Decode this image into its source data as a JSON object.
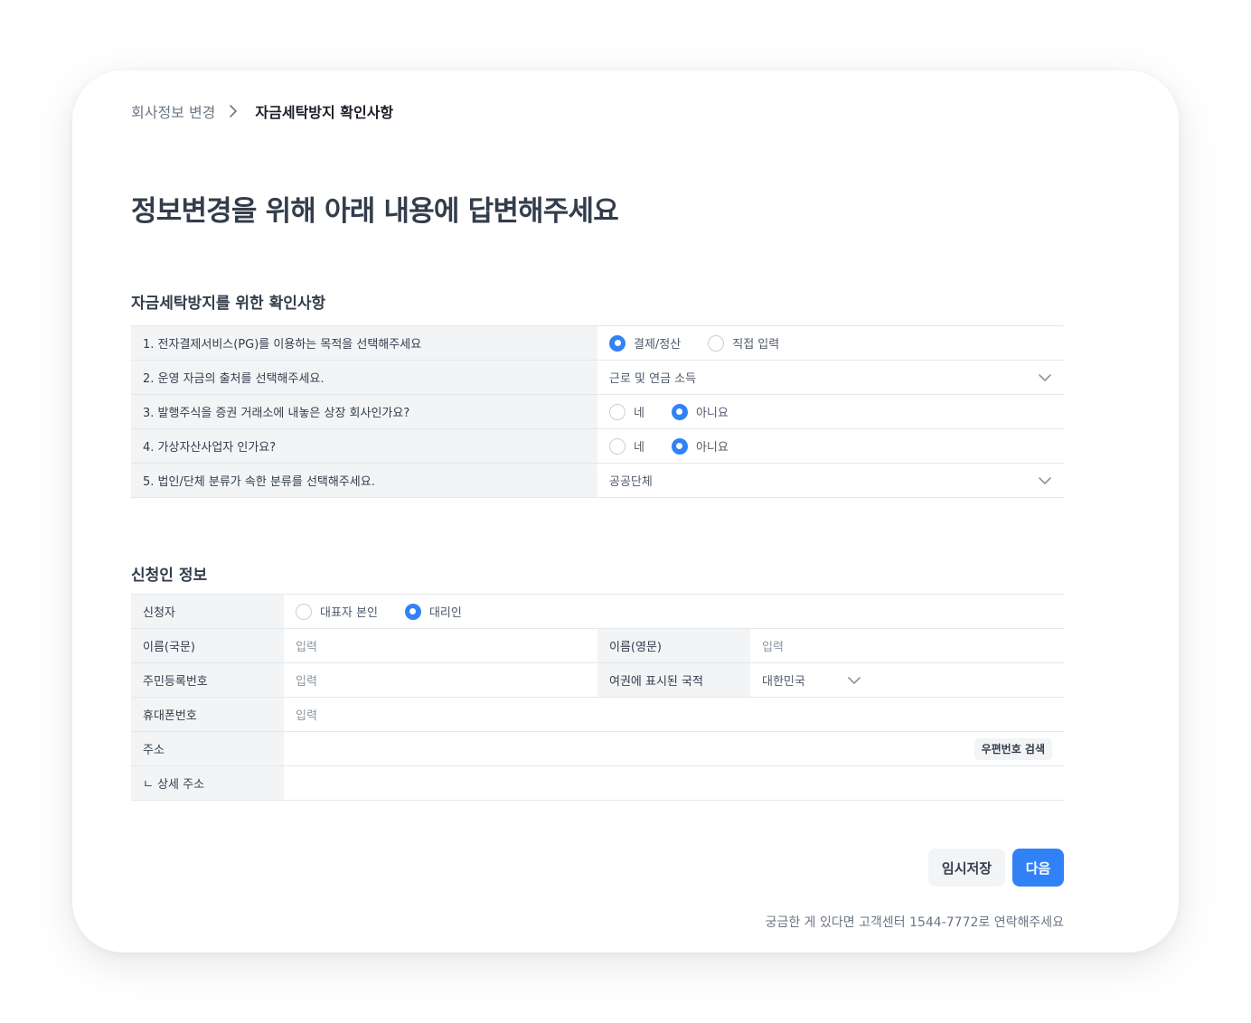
{
  "breadcrumb": {
    "parent": "회사정보 변경",
    "current": "자금세탁방지 확인사항"
  },
  "page_title": "정보변경을 위해 아래 내용에 답변해주세요",
  "aml_section": {
    "title": "자금세탁방지를 위한 확인사항",
    "q1": {
      "label": "1. 전자결제서비스(PG)를 이용하는 목적을 선택해주세요",
      "options": [
        "결제/정산",
        "직접 입력"
      ],
      "selected": "결제/정산"
    },
    "q2": {
      "label": "2. 운영 자금의 출처를 선택해주세요.",
      "value": "근로 및 연금 소득"
    },
    "q3": {
      "label": "3. 발행주식을 증권 거래소에 내놓은 상장 회사인가요?",
      "options": [
        "네",
        "아니요"
      ],
      "selected": "아니요"
    },
    "q4": {
      "label": "4. 가상자산사업자 인가요?",
      "options": [
        "네",
        "아니요"
      ],
      "selected": "아니요"
    },
    "q5": {
      "label": "5. 법인/단체 분류가 속한 분류를 선택해주세요.",
      "value": "공공단체"
    }
  },
  "applicant_section": {
    "title": "신청인 정보",
    "applicant": {
      "label": "신청자",
      "options": [
        "대표자 본인",
        "대리인"
      ],
      "selected": "대리인"
    },
    "name_kr": {
      "label": "이름(국문)",
      "placeholder": "입력"
    },
    "name_en": {
      "label": "이름(영문)",
      "placeholder": "입력"
    },
    "rrn": {
      "label": "주민등록번호",
      "placeholder": "입력"
    },
    "nationality": {
      "label": "여권에 표시된 국적",
      "value": "대한민국"
    },
    "phone": {
      "label": "휴대폰번호",
      "placeholder": "입력"
    },
    "address": {
      "label": "주소",
      "search_button": "우편번호 검색"
    },
    "address_detail": {
      "label": "ㄴ 상세 주소"
    }
  },
  "actions": {
    "save_draft": "임시저장",
    "next": "다음"
  },
  "help_text": "궁금한 게 있다면 고객센터 1544-7772로 연락해주세요",
  "colors": {
    "accent": "#3182f6",
    "label_bg": "#f2f4f6",
    "border": "#e5e8eb",
    "text_primary": "#333d4b",
    "text_secondary": "#6b7684"
  },
  "icons": {
    "breadcrumb_separator": "chevron-right-icon",
    "select_arrow": "chevron-down-icon"
  }
}
